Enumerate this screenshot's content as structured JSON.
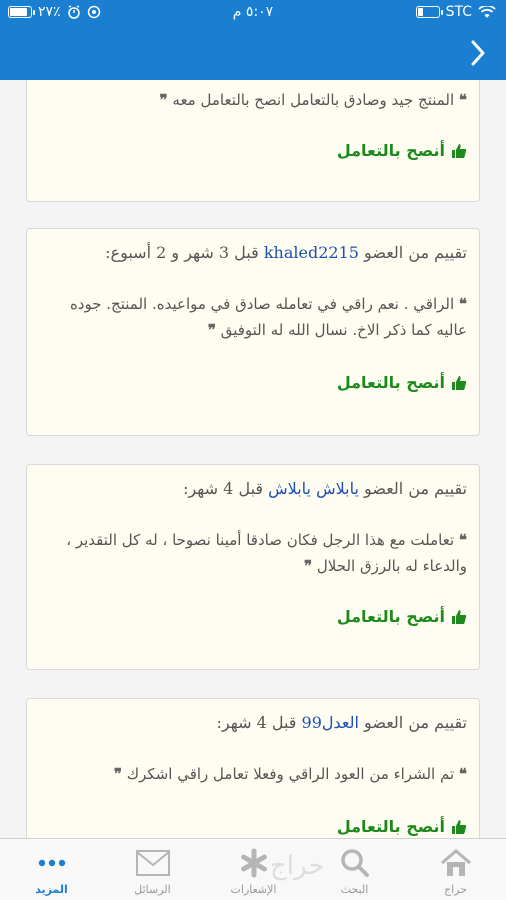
{
  "status_bar": {
    "carrier": "STC",
    "time": "٥:٠٧ م",
    "battery_percent": "٢٧٪"
  },
  "nav": {
    "back_label": "›"
  },
  "reviews": [
    {
      "header_prefix": "",
      "username": "",
      "header_suffix": "",
      "text": "المنتج جيد وصادق بالتعامل انصح بالتعامل معه",
      "recommend": "أنصح بالتعامل"
    },
    {
      "header_prefix": "تقييم من العضو",
      "username": "khaled2215",
      "header_suffix": "قبل 3 شهر و 2 أسبوع:",
      "text": "الراقي . نعم راقي في تعامله صادق في مواعيده. المنتج. جوده عاليه كما ذكر الاخ. نسال الله له التوفيق",
      "recommend": "أنصح بالتعامل"
    },
    {
      "header_prefix": "تقييم من العضو",
      "username": "يابلاش يابلاش",
      "header_suffix": "قبل 4 شهر:",
      "text": "تعاملت مع هذا الرجل فكان صادقا أمينا نصوحا ، له كل التقدير ، والدعاء له بالرزق الحلال",
      "recommend": "أنصح بالتعامل"
    },
    {
      "header_prefix": "تقييم من العضو",
      "username": "العدل99",
      "header_suffix": "قبل 4 شهر:",
      "text": "تم الشراء من العود الراقي وفعلا تعامل راقي اشكرك",
      "recommend": "أنصح بالتعامل"
    }
  ],
  "tabs": [
    {
      "label": "حراج",
      "icon": "home-icon"
    },
    {
      "label": "البحث",
      "icon": "search-icon"
    },
    {
      "label": "الإشعارات",
      "icon": "asterisk-icon"
    },
    {
      "label": "الرسائل",
      "icon": "mail-icon"
    },
    {
      "label": "المزيد",
      "icon": "more-icon"
    }
  ],
  "watermark": "حراج",
  "colors": {
    "brand_blue": "#1a7fd1",
    "recommend_green": "#1e8a1e",
    "username_blue": "#1b4fb3"
  }
}
